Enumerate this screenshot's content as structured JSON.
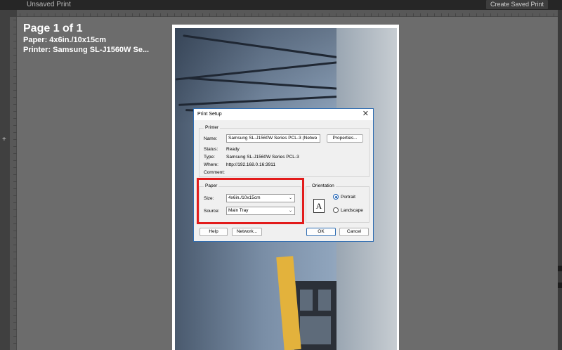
{
  "app": {
    "doc_title": "Unsaved Print",
    "create_saved_print": "Create Saved Print"
  },
  "info": {
    "page": "Page 1 of 1",
    "paper": "Paper:  4x6in./10x15cm",
    "printer": "Printer:  Samsung SL-J1560W Se..."
  },
  "dialog": {
    "title": "Print Setup",
    "printer_group": "Printer",
    "name_label": "Name:",
    "name_value": "Samsung SL-J1560W Series PCL-3 (Netwo",
    "properties_button": "Properties...",
    "status_label": "Status:",
    "status_value": "Ready",
    "type_label": "Type:",
    "type_value": "Samsung SL-J1560W Series PCL-3",
    "where_label": "Where:",
    "where_value": "http://192.168.0.16:3911",
    "comment_label": "Comment:",
    "paper_group": "Paper",
    "size_label": "Size:",
    "size_value": "4x6in./10x15cm",
    "source_label": "Source:",
    "source_value": "Main Tray",
    "orientation_group": "Orientation",
    "portrait_label": "Portrait",
    "landscape_label": "Landscape",
    "orientation_selected": "Portrait",
    "portrait_glyph": "A",
    "help_button": "Help",
    "network_button": "Network...",
    "ok_button": "OK",
    "cancel_button": "Cancel"
  },
  "colors": {
    "highlight": "#e21b1b",
    "accent": "#2f6db2"
  }
}
